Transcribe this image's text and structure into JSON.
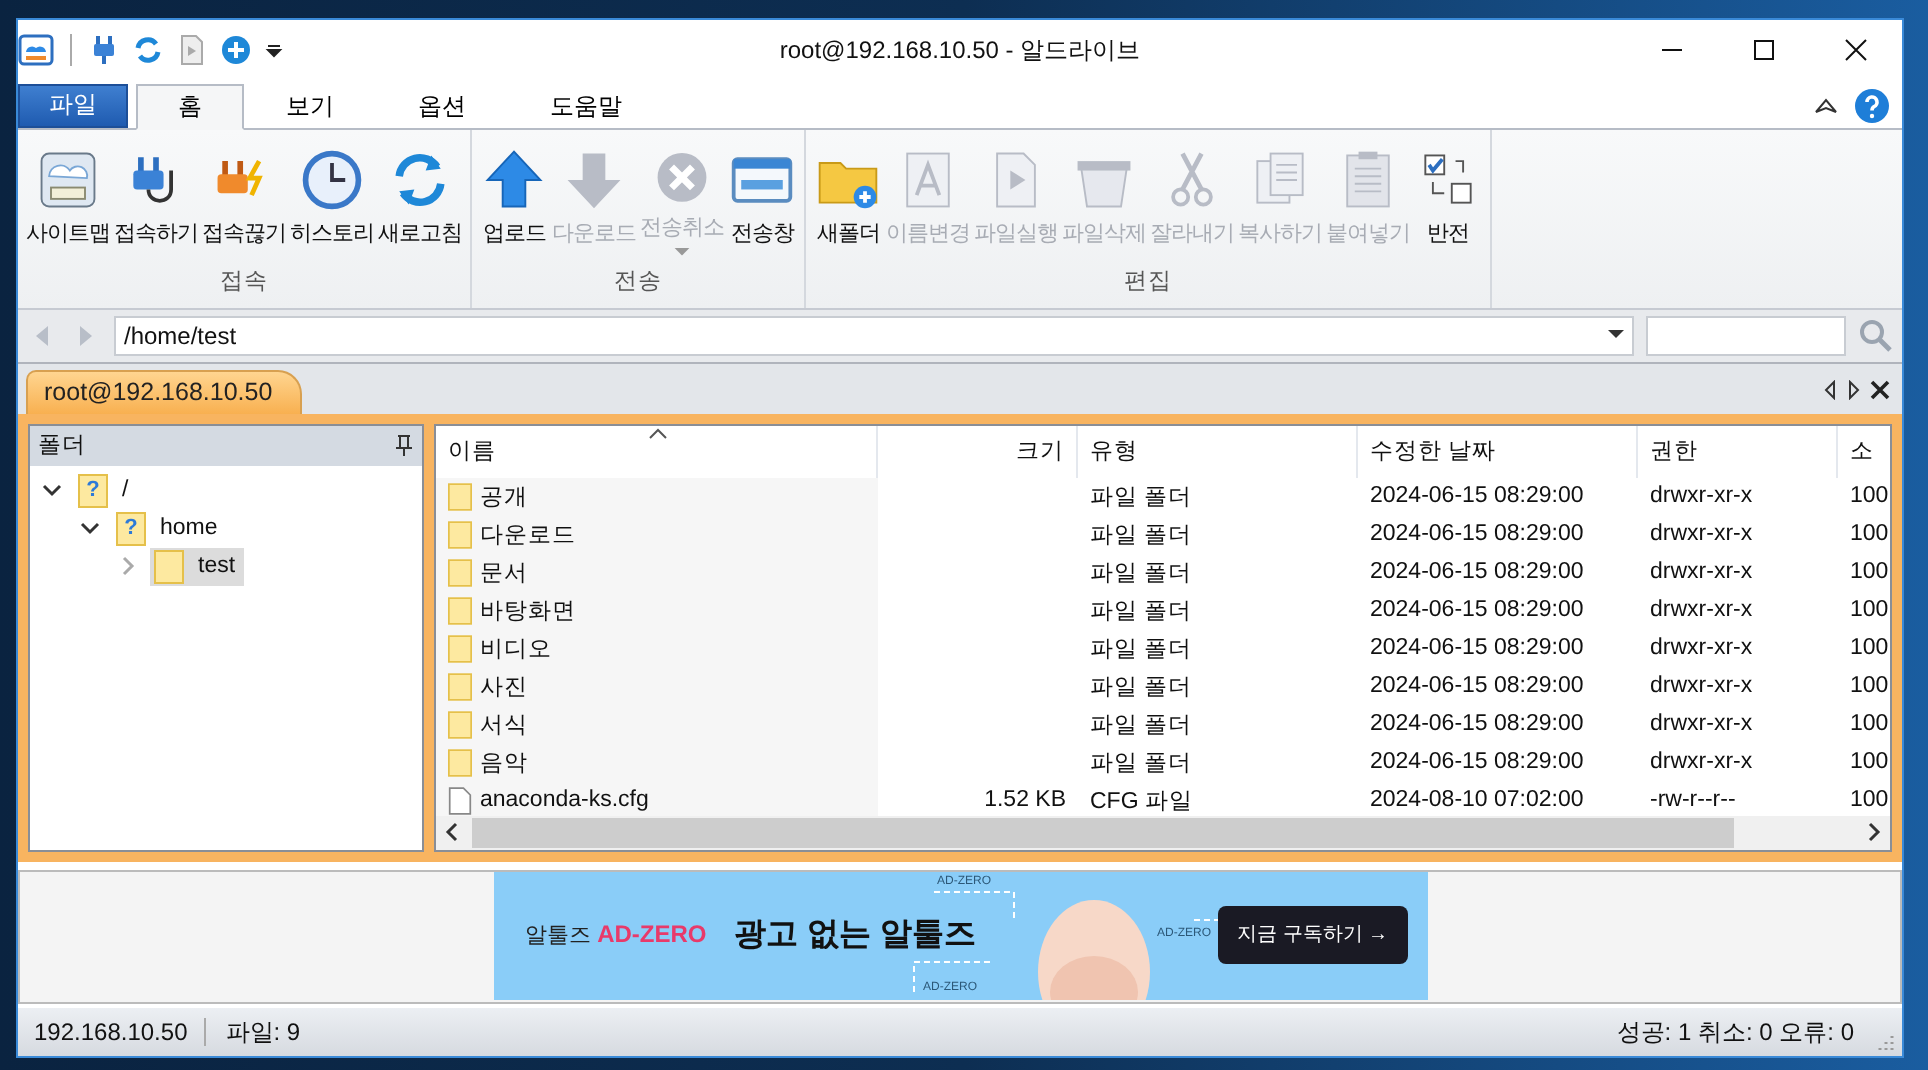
{
  "window": {
    "title": "root@192.168.10.50 - 알드라이브"
  },
  "ribbon": {
    "file_tab": "파일",
    "tabs": [
      {
        "label": "홈",
        "selected": true
      },
      {
        "label": "보기",
        "selected": false
      },
      {
        "label": "옵션",
        "selected": false
      },
      {
        "label": "도움말",
        "selected": false
      }
    ],
    "groups": [
      {
        "label": "접속",
        "buttons": [
          {
            "label": "사이트맵",
            "disabled": false,
            "dropdown": false
          },
          {
            "label": "접속하기",
            "disabled": false,
            "dropdown": false
          },
          {
            "label": "접속끊기",
            "disabled": false,
            "dropdown": false
          },
          {
            "label": "히스토리",
            "disabled": false,
            "dropdown": false
          },
          {
            "label": "새로고침",
            "disabled": false,
            "dropdown": false
          }
        ]
      },
      {
        "label": "전송",
        "buttons": [
          {
            "label": "업로드",
            "disabled": false,
            "dropdown": false
          },
          {
            "label": "다운로드",
            "disabled": true,
            "dropdown": false
          },
          {
            "label": "전송취소",
            "disabled": true,
            "dropdown": true
          },
          {
            "label": "전송창",
            "disabled": false,
            "dropdown": false
          }
        ]
      },
      {
        "label": "편집",
        "buttons": [
          {
            "label": "새폴더",
            "disabled": false,
            "dropdown": false
          },
          {
            "label": "이름변경",
            "disabled": true,
            "dropdown": false
          },
          {
            "label": "파일실행",
            "disabled": true,
            "dropdown": false
          },
          {
            "label": "파일삭제",
            "disabled": true,
            "dropdown": false
          },
          {
            "label": "잘라내기",
            "disabled": true,
            "dropdown": false
          },
          {
            "label": "복사하기",
            "disabled": true,
            "dropdown": false
          },
          {
            "label": "붙여넣기",
            "disabled": true,
            "dropdown": false
          },
          {
            "label": "반전",
            "disabled": false,
            "dropdown": false
          }
        ]
      }
    ]
  },
  "address": {
    "path": "/home/test"
  },
  "connection_tabs": [
    {
      "label": "root@192.168.10.50",
      "selected": true
    }
  ],
  "folder_panel": {
    "title": "폴더",
    "tree": [
      {
        "label": "/",
        "expanded": true,
        "selected": false,
        "badge": "?",
        "children": [
          {
            "label": "home",
            "expanded": true,
            "selected": false,
            "badge": "?",
            "children": [
              {
                "label": "test",
                "expanded": false,
                "selected": true
              }
            ]
          }
        ]
      }
    ]
  },
  "file_list": {
    "columns": [
      "이름",
      "크기",
      "유형",
      "수정한 날짜",
      "권한",
      "소"
    ],
    "rows": [
      {
        "kind": "folder",
        "name": "공개",
        "size": "",
        "type": "파일 폴더",
        "modified": "2024-06-15 08:29:00",
        "permissions": "drwxr-xr-x",
        "owner": "100"
      },
      {
        "kind": "folder",
        "name": "다운로드",
        "size": "",
        "type": "파일 폴더",
        "modified": "2024-06-15 08:29:00",
        "permissions": "drwxr-xr-x",
        "owner": "100"
      },
      {
        "kind": "folder",
        "name": "문서",
        "size": "",
        "type": "파일 폴더",
        "modified": "2024-06-15 08:29:00",
        "permissions": "drwxr-xr-x",
        "owner": "100"
      },
      {
        "kind": "folder",
        "name": "바탕화면",
        "size": "",
        "type": "파일 폴더",
        "modified": "2024-06-15 08:29:00",
        "permissions": "drwxr-xr-x",
        "owner": "100"
      },
      {
        "kind": "folder",
        "name": "비디오",
        "size": "",
        "type": "파일 폴더",
        "modified": "2024-06-15 08:29:00",
        "permissions": "drwxr-xr-x",
        "owner": "100"
      },
      {
        "kind": "folder",
        "name": "사진",
        "size": "",
        "type": "파일 폴더",
        "modified": "2024-06-15 08:29:00",
        "permissions": "drwxr-xr-x",
        "owner": "100"
      },
      {
        "kind": "folder",
        "name": "서식",
        "size": "",
        "type": "파일 폴더",
        "modified": "2024-06-15 08:29:00",
        "permissions": "drwxr-xr-x",
        "owner": "100"
      },
      {
        "kind": "folder",
        "name": "음악",
        "size": "",
        "type": "파일 폴더",
        "modified": "2024-06-15 08:29:00",
        "permissions": "drwxr-xr-x",
        "owner": "100"
      },
      {
        "kind": "file",
        "name": "anaconda-ks.cfg",
        "size": "1.52 KB",
        "type": "CFG 파일",
        "modified": "2024-08-10 07:02:00",
        "permissions": "-rw-r--r--",
        "owner": "100"
      }
    ]
  },
  "ad": {
    "brand": "알툴즈",
    "product": "AD-ZERO",
    "headline": "광고 없는 알툴즈",
    "cta": "지금 구독하기 →",
    "tags": [
      "AD-ZERO",
      "AD-ZERO",
      "AD-ZERO"
    ]
  },
  "status_bar": {
    "host": "192.168.10.50",
    "files": "파일: 9",
    "results": "성공: 1 취소: 0 오류: 0"
  }
}
